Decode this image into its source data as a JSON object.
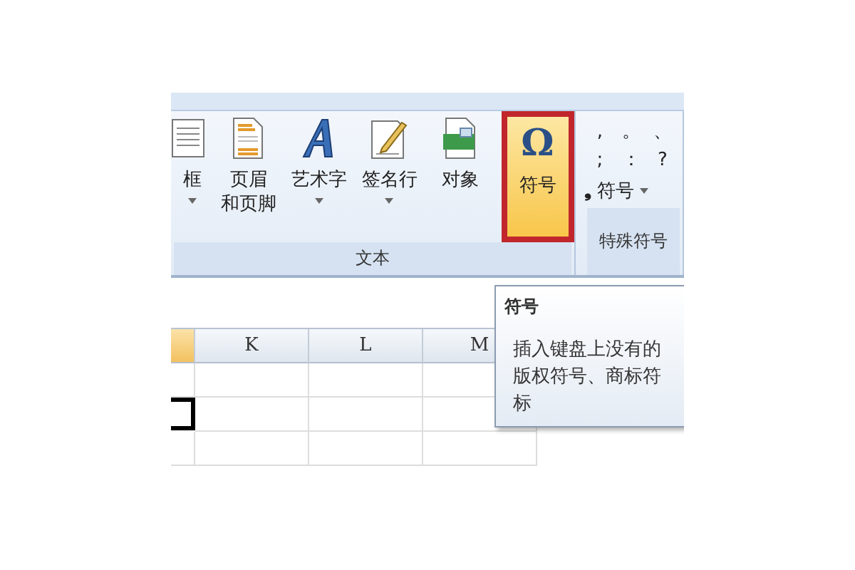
{
  "ribbon": {
    "groups": [
      {
        "label": "文本",
        "buttons": [
          {
            "kind": "textbox",
            "lines": [
              "框"
            ],
            "dropdown": true,
            "selected": false
          },
          {
            "kind": "header",
            "lines": [
              "页眉",
              "和页脚"
            ],
            "dropdown": false,
            "selected": false
          },
          {
            "kind": "wordart",
            "lines": [
              "艺术字"
            ],
            "dropdown": true,
            "selected": false
          },
          {
            "kind": "signature",
            "lines": [
              "签名行"
            ],
            "dropdown": true,
            "selected": false
          },
          {
            "kind": "object",
            "lines": [
              "对象"
            ],
            "dropdown": false,
            "selected": false
          },
          {
            "kind": "symbol",
            "glyph": "Ω",
            "lines": [
              "符号"
            ],
            "dropdown": false,
            "selected": true
          }
        ]
      },
      {
        "label": "特殊符号",
        "symbols": [
          ",",
          "。",
          "、",
          ";",
          "：",
          "?"
        ],
        "more": {
          "glyph": "❟",
          "label": "符号",
          "dropdown": true
        }
      }
    ]
  },
  "sheet": {
    "columns": [
      {
        "selected": true
      },
      {
        "label": "K",
        "selected": false
      },
      {
        "label": "L",
        "selected": false
      },
      {
        "label": "M",
        "selected": false
      }
    ]
  },
  "tooltip": {
    "title": "符号",
    "lines": [
      "插入键盘上没有的",
      "版权符号、商标符",
      "标"
    ]
  }
}
